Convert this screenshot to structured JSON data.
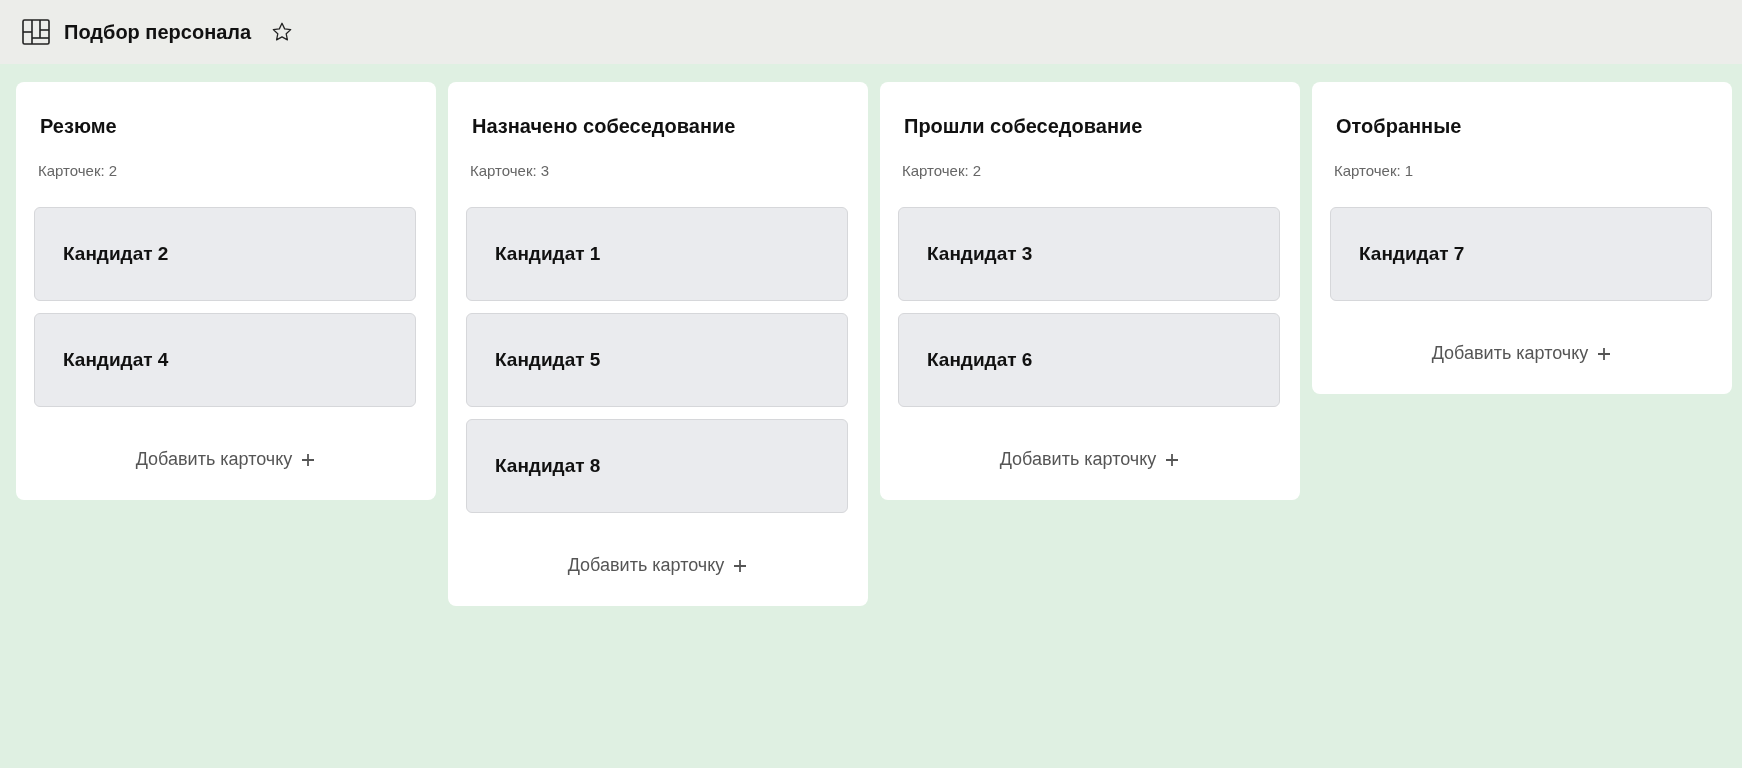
{
  "board": {
    "title": "Подбор персонала",
    "starred": false
  },
  "columns": [
    {
      "title": "Резюме",
      "count": "Карточек: 2",
      "cards": [
        "Кандидат 2",
        "Кандидат 4"
      ],
      "add_label": "Добавить карточку"
    },
    {
      "title": "Назначено собеседование",
      "count": "Карточек: 3",
      "cards": [
        "Кандидат 1",
        "Кандидат 5",
        "Кандидат 8"
      ],
      "add_label": "Добавить карточку"
    },
    {
      "title": "Прошли собеседование",
      "count": "Карточек: 2",
      "cards": [
        "Кандидат 3",
        "Кандидат 6"
      ],
      "add_label": "Добавить карточку"
    },
    {
      "title": "Отобранные",
      "count": "Карточек: 1",
      "cards": [
        "Кандидат 7"
      ],
      "add_label": "Добавить карточку"
    }
  ]
}
